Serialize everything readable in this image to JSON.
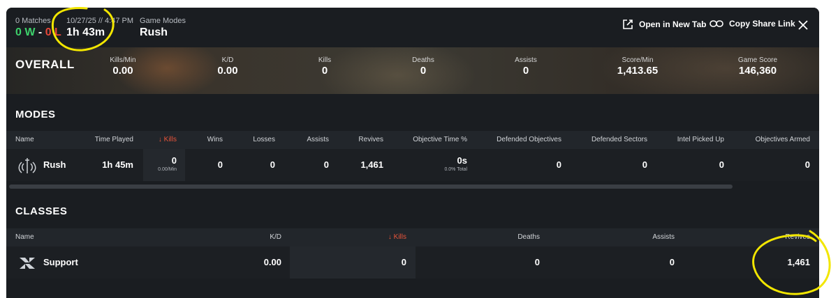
{
  "header": {
    "matches_label": "0 Matches",
    "wins": "0 W",
    "sep": "-",
    "losses": "0 L",
    "datetime": "10/27/25 // 4:47 PM",
    "duration": "1h 43m",
    "modes_label": "Game Modes",
    "modes_value": "Rush",
    "open_tab_label": "Open in New Tab",
    "copy_link_label": "Copy Share Link"
  },
  "overall": {
    "title": "OVERALL",
    "stats": [
      {
        "label": "Kills/Min",
        "value": "0.00"
      },
      {
        "label": "K/D",
        "value": "0.00"
      },
      {
        "label": "Kills",
        "value": "0"
      },
      {
        "label": "Deaths",
        "value": "0"
      },
      {
        "label": "Assists",
        "value": "0"
      },
      {
        "label": "Score/Min",
        "value": "1,413.65"
      },
      {
        "label": "Game Score",
        "value": "146,360"
      }
    ]
  },
  "modes": {
    "title": "MODES",
    "columns": [
      "Name",
      "Time Played",
      "Kills",
      "Wins",
      "Losses",
      "Assists",
      "Revives",
      "Objective Time %",
      "Defended Objectives",
      "Defended Sectors",
      "Intel Picked Up",
      "Objectives Armed"
    ],
    "row": {
      "icon": "rush-icon",
      "name": "Rush",
      "time_played": "1h 45m",
      "kills": "0",
      "kills_sub": "0.00/Min",
      "wins": "0",
      "losses": "0",
      "assists": "0",
      "revives": "1,461",
      "objective_time": "0s",
      "objective_time_sub": "0.0% Total",
      "defended_objectives": "0",
      "defended_sectors": "0",
      "intel_picked_up": "0",
      "objectives_armed": "0"
    }
  },
  "classes": {
    "title": "CLASSES",
    "columns": [
      "Name",
      "K/D",
      "Kills",
      "Deaths",
      "Assists",
      "Revives"
    ],
    "row": {
      "icon": "support-class-icon",
      "name": "Support",
      "kd": "0.00",
      "kills": "0",
      "deaths": "0",
      "assists": "0",
      "revives": "1,461"
    }
  },
  "colors": {
    "win": "#3dd16b",
    "loss": "#e8483a",
    "sort_accent": "#e8543a",
    "annotation": "#f2e600"
  }
}
